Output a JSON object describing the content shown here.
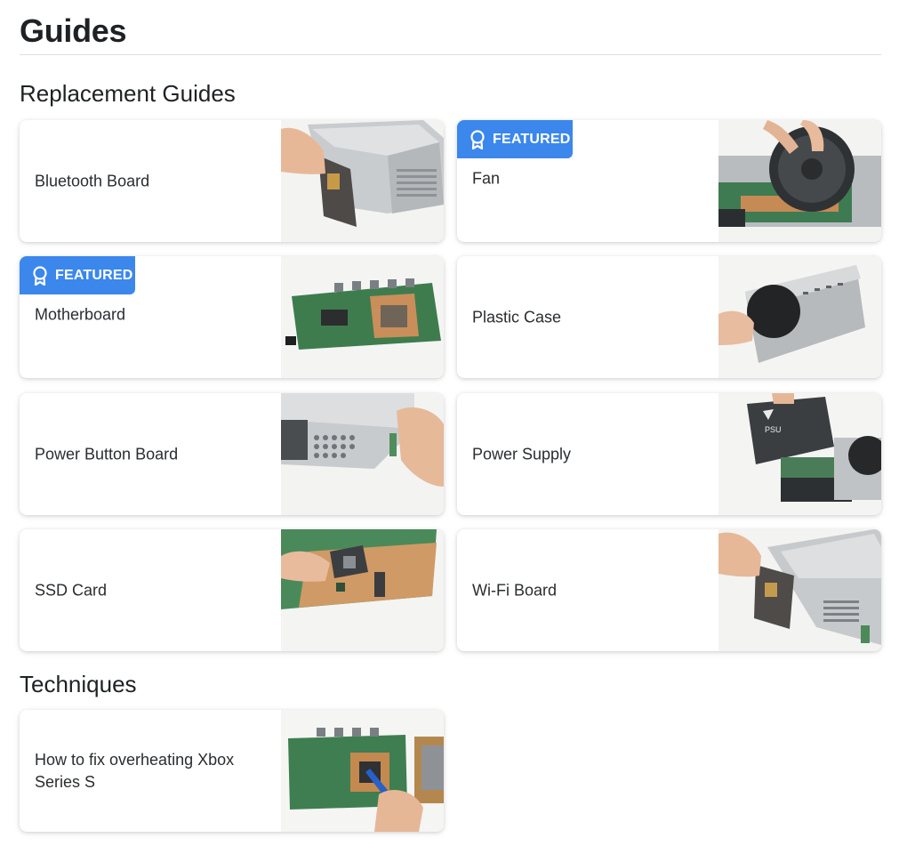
{
  "page": {
    "title": "Guides"
  },
  "replacement": {
    "title": "Replacement Guides",
    "badge_text": "FEATURED",
    "cards": [
      {
        "label": "Bluetooth Board",
        "featured": false,
        "image": "bluetooth-board-photo"
      },
      {
        "label": "Fan",
        "featured": true,
        "image": "fan-photo"
      },
      {
        "label": "Motherboard",
        "featured": true,
        "image": "motherboard-photo"
      },
      {
        "label": "Plastic Case",
        "featured": false,
        "image": "plastic-case-photo"
      },
      {
        "label": "Power Button Board",
        "featured": false,
        "image": "power-button-board-photo"
      },
      {
        "label": "Power Supply",
        "featured": false,
        "image": "power-supply-photo"
      },
      {
        "label": "SSD Card",
        "featured": false,
        "image": "ssd-card-photo"
      },
      {
        "label": "Wi-Fi Board",
        "featured": false,
        "image": "wifi-board-photo"
      }
    ]
  },
  "techniques": {
    "title": "Techniques",
    "cards": [
      {
        "label": "How to fix overheating Xbox Series S",
        "image": "overheating-fix-photo"
      }
    ]
  },
  "colors": {
    "badge": "#3b87ec",
    "text": "#212426",
    "rule": "#dcdfe2"
  }
}
